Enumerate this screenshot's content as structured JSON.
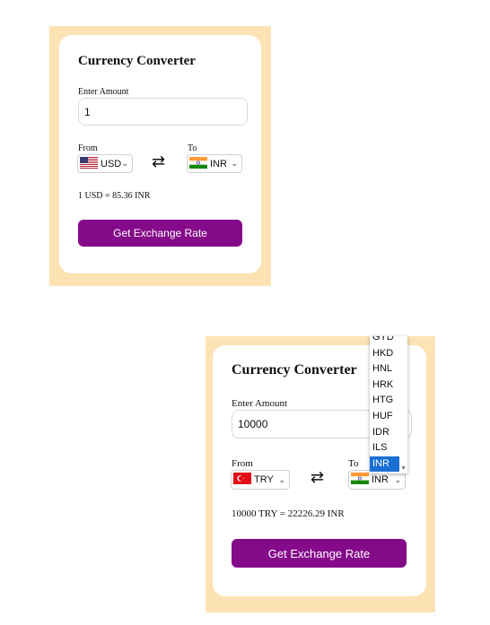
{
  "screen1": {
    "title": "Currency Converter",
    "amount_label": "Enter Amount",
    "amount_value": "1",
    "from_label": "From",
    "to_label": "To",
    "from_currency": "USD",
    "to_currency": "INR",
    "swap_icon": "⇄",
    "result": "1 USD = 85.36 INR",
    "button": "Get Exchange Rate"
  },
  "screen2": {
    "title": "Currency Converter",
    "amount_label": "Enter Amount",
    "amount_value": "10000",
    "from_label": "From",
    "to_label": "To",
    "from_currency": "TRY",
    "to_currency": "INR",
    "swap_icon": "⇄",
    "result": "10000 TRY = 22226.29 INR",
    "button": "Get Exchange Rate",
    "dropdown_options": [
      "GYD",
      "HKD",
      "HNL",
      "HRK",
      "HTG",
      "HUF",
      "IDR",
      "ILS",
      "INR"
    ],
    "dropdown_selected": "INR"
  },
  "colors": {
    "frame_bg": "#fde3b4",
    "button_bg": "#850a8a",
    "selected_option_bg": "#1a6fd6"
  },
  "icons": {
    "chevron": "chevron-down-icon",
    "swap": "swap-arrows-icon",
    "flags": [
      "us-flag-icon",
      "india-flag-icon",
      "turkey-flag-icon"
    ]
  }
}
